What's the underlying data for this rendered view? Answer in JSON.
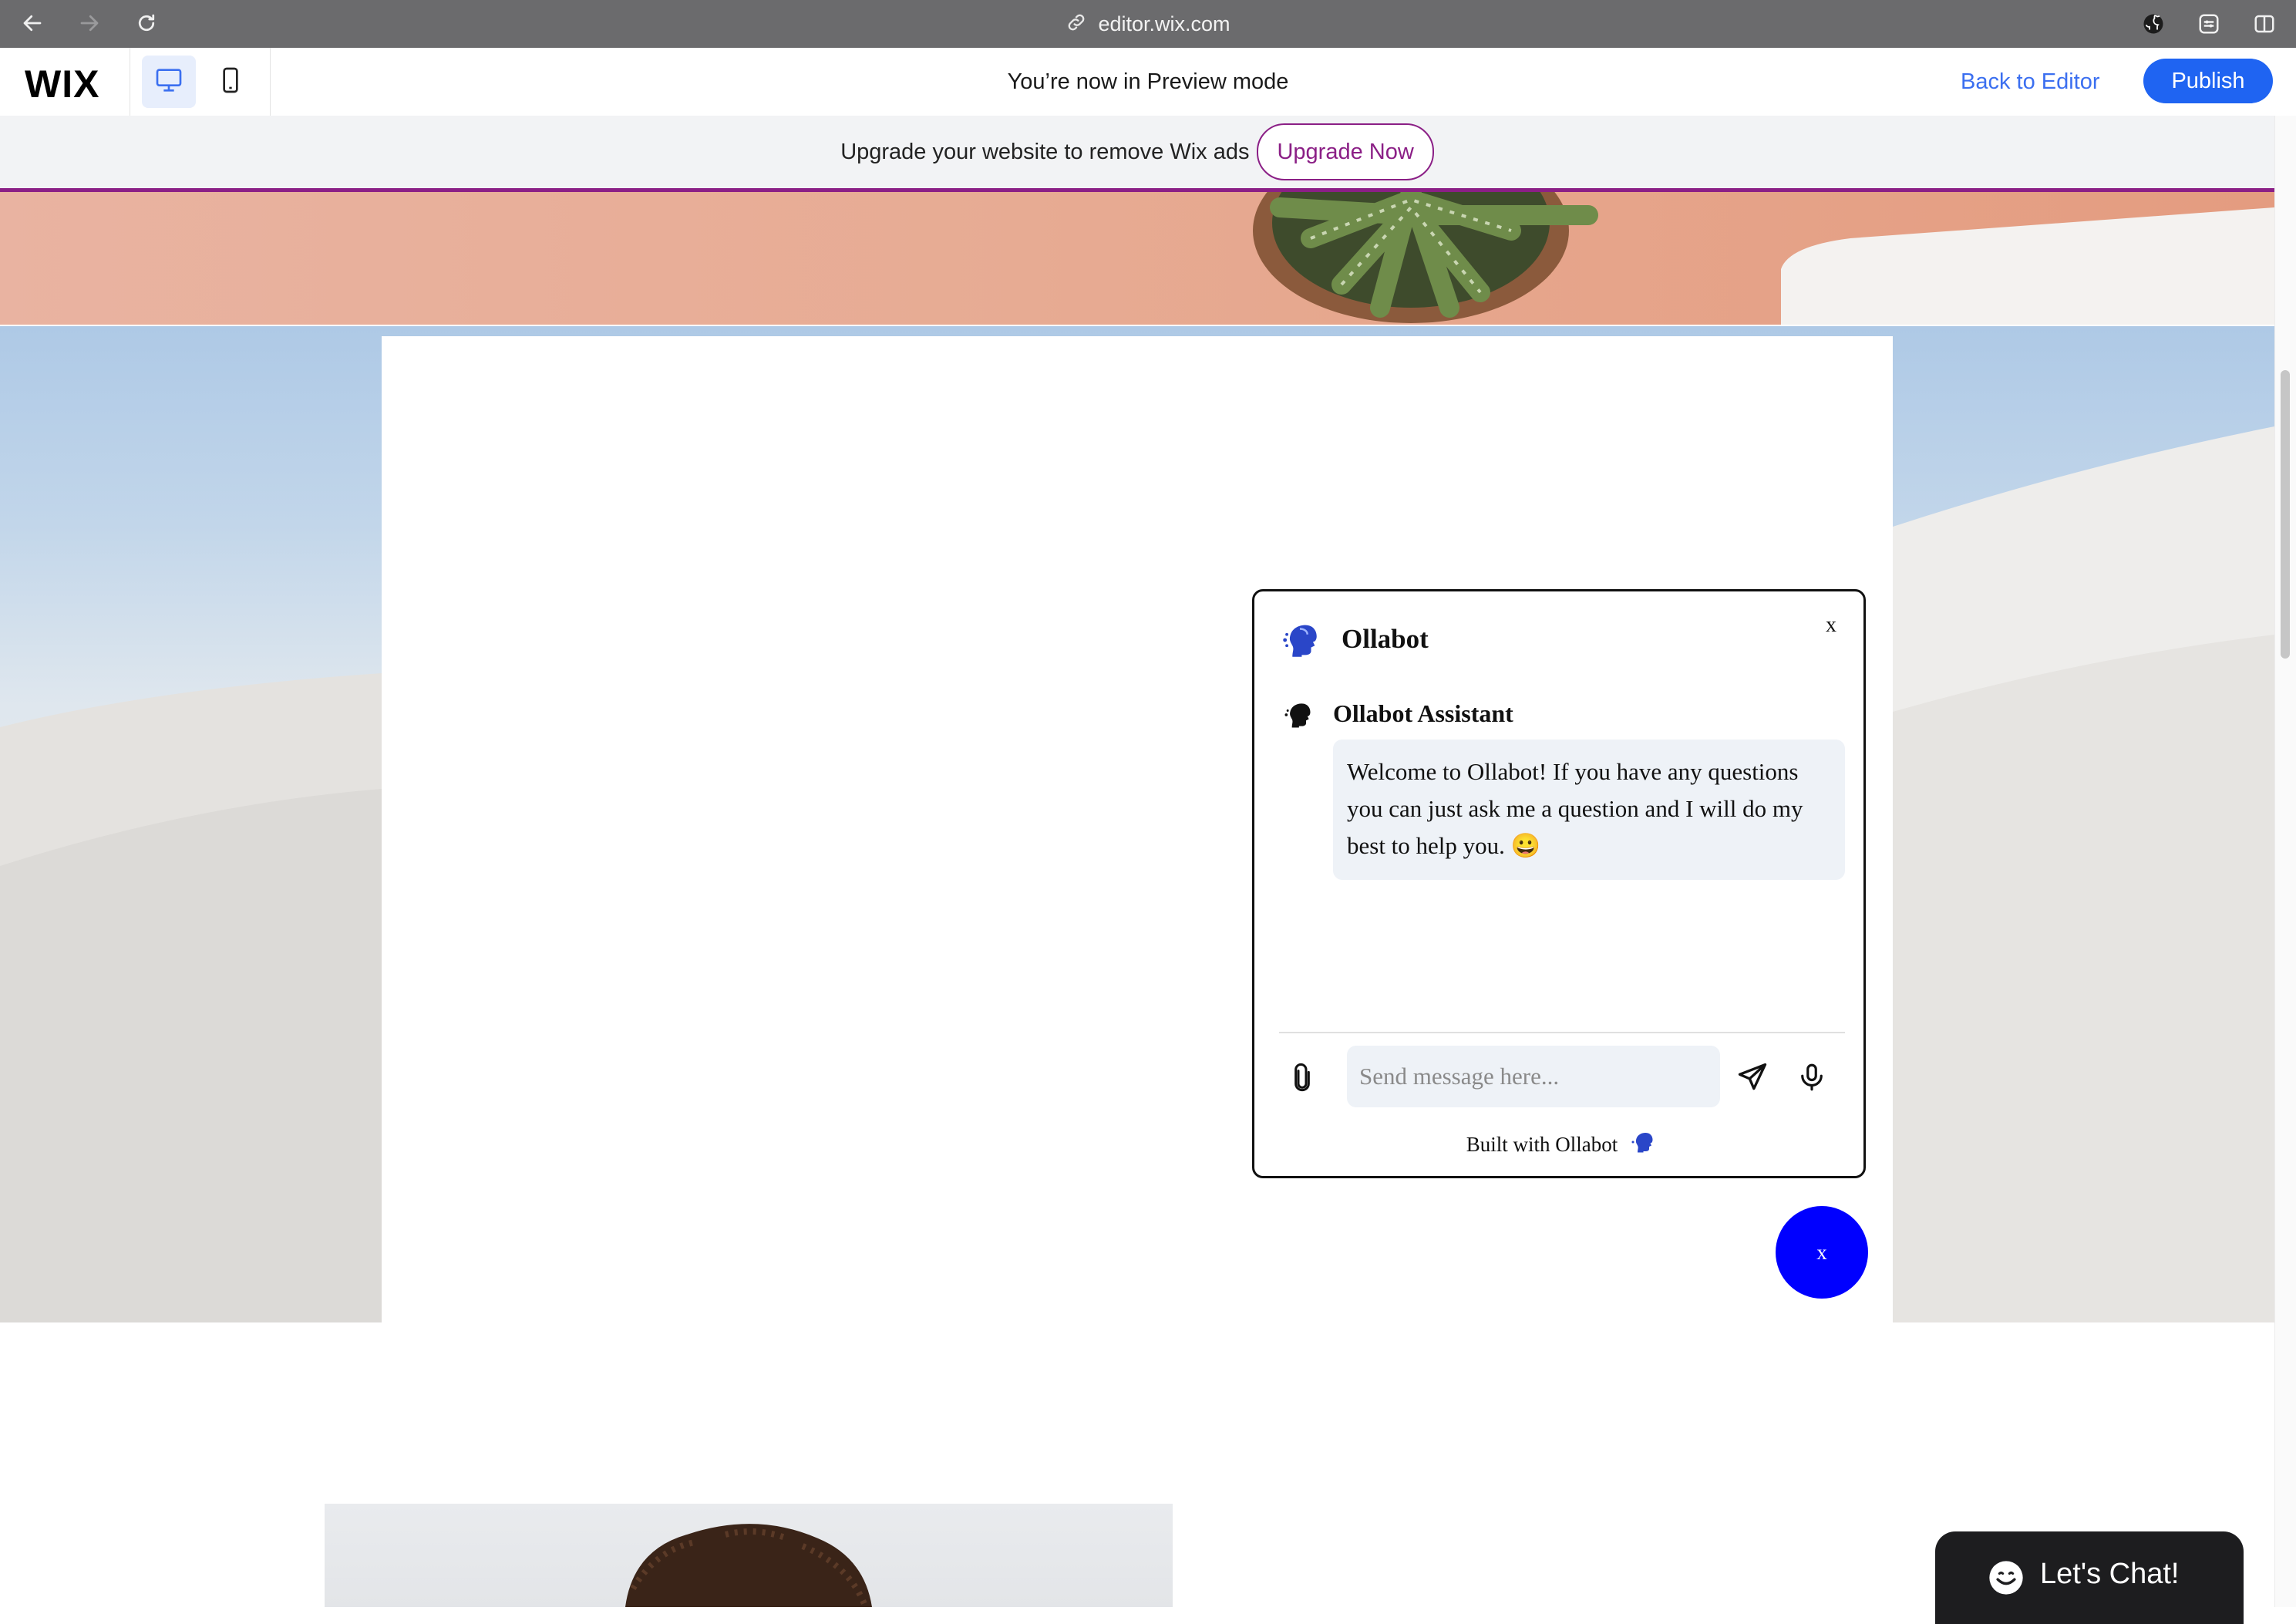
{
  "browser": {
    "url": "editor.wix.com",
    "icons": [
      "back-arrow-icon",
      "forward-arrow-icon",
      "reload-icon",
      "link-icon",
      "github-icon",
      "extension-icon",
      "sidebar-icon"
    ]
  },
  "wix_bar": {
    "logo": "WIX",
    "preview_message": "You’re now in Preview mode",
    "back_to_editor": "Back to Editor",
    "publish": "Publish",
    "accent_color": "#1f64f2"
  },
  "ad_banner": {
    "text": "Upgrade your website to remove Wix ads",
    "button": "Upgrade Now",
    "accent_color": "#8b1f86"
  },
  "chat_widget": {
    "title": "Ollabot",
    "close": "x",
    "assistant_name": "Ollabot Assistant",
    "welcome_message": "Welcome to Ollabot! If you have any questions you can just ask me a question and I will do my best to help you. 😀",
    "input_placeholder": "Send message here...",
    "footer": "Built with Ollabot",
    "toggle_label": "x",
    "toggle_color": "#0000ff"
  },
  "lets_chat": {
    "label": "Let's Chat!"
  }
}
